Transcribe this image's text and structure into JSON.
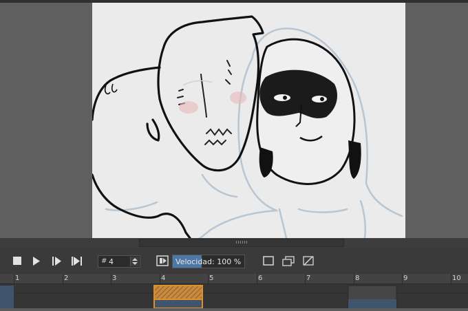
{
  "playback": {
    "stop_icon": "stop-icon",
    "play_icon": "play-icon",
    "next_frame_icon": "step-forward-icon",
    "last_frame_icon": "skip-to-end-icon"
  },
  "frame": {
    "prefix": "#",
    "value": "4"
  },
  "speed": {
    "label": "Velocidad: 100 %",
    "level_fraction": 0.4
  },
  "view_icons": [
    "onion-skin-icon",
    "single-frame-icon",
    "multi-frame-icon",
    "no-onion-icon"
  ],
  "timeline": {
    "ruler_labels": [
      "1",
      "2",
      "3",
      "4",
      "5",
      "6",
      "7",
      "8",
      "9",
      "10"
    ],
    "selected_frame": 4,
    "colors": {
      "selected": "#e0902d",
      "frame_block": "#40546e",
      "accent": "#4e78a5"
    }
  }
}
